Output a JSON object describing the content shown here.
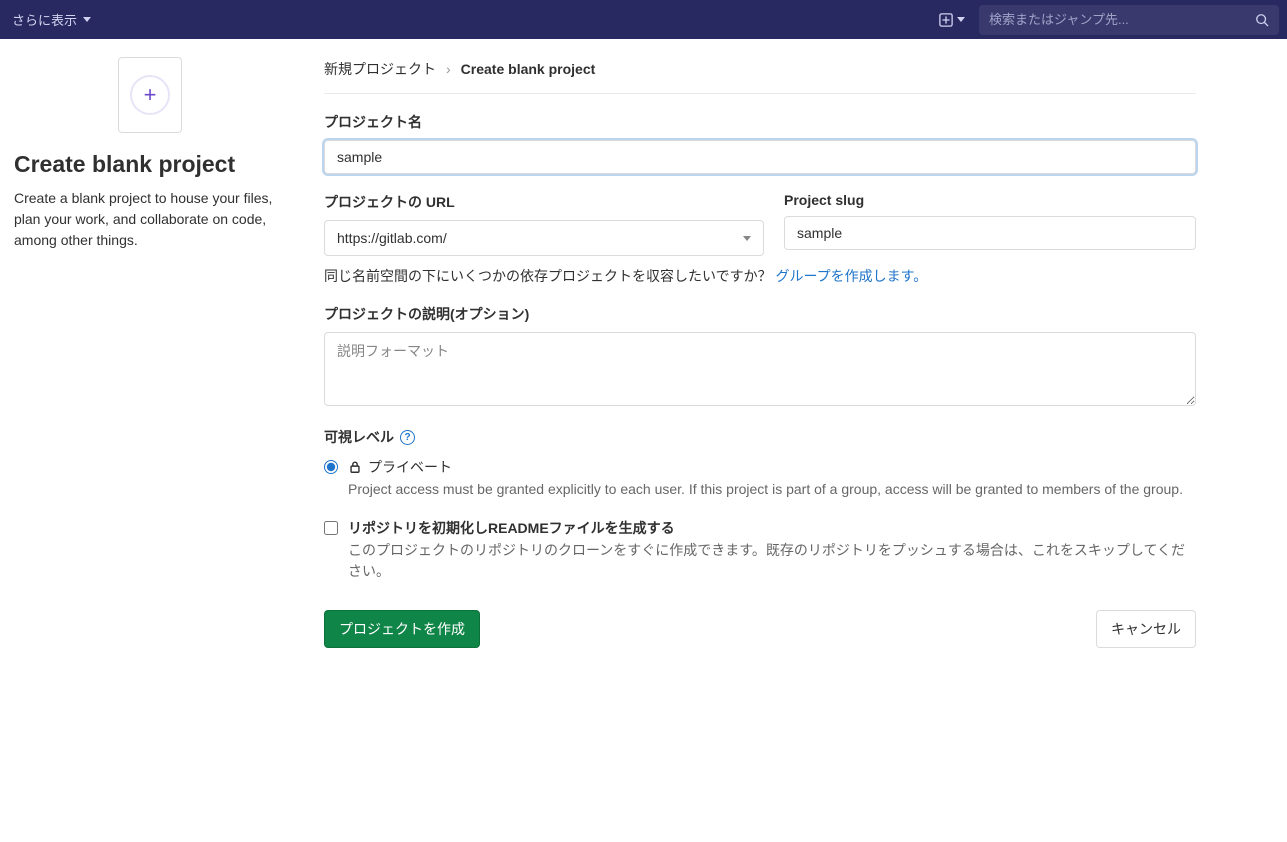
{
  "topbar": {
    "more_label": "さらに表示",
    "search_placeholder": "検索またはジャンプ先..."
  },
  "sidebar": {
    "title": "Create blank project",
    "description": "Create a blank project to house your files, plan your work, and collaborate on code, among other things."
  },
  "breadcrumb": {
    "root": "新規プロジェクト",
    "current": "Create blank project",
    "sep": "›"
  },
  "form": {
    "name_label": "プロジェクト名",
    "name_value": "sample",
    "url_label": "プロジェクトの URL",
    "url_value": "https://gitlab.com/",
    "slug_label": "Project slug",
    "slug_value": "sample",
    "namespace_help": "同じ名前空間の下にいくつかの依存プロジェクトを収容したいですか？",
    "namespace_link": "グループを作成します。",
    "description_label": "プロジェクトの説明(オプション)",
    "description_placeholder": "説明フォーマット",
    "visibility_label": "可視レベル",
    "visibility_private_label": "プライベート",
    "visibility_private_desc": "Project access must be granted explicitly to each user. If this project is part of a group, access will be granted to members of the group.",
    "readme_label": "リポジトリを初期化しREADMEファイルを生成する",
    "readme_desc": "このプロジェクトのリポジトリのクローンをすぐに作成できます。既存のリポジトリをプッシュする場合は、これをスキップしてください。",
    "submit_label": "プロジェクトを作成",
    "cancel_label": "キャンセル"
  }
}
